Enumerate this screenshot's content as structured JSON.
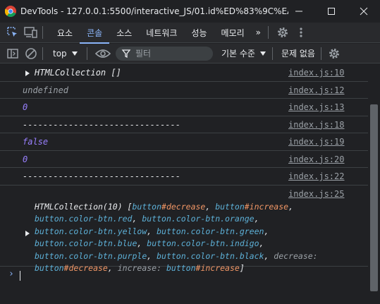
{
  "window": {
    "title": "DevTools - 127.0.0.1:5500/interactive_JS/01.id%ED%83%9C%EA%B7...",
    "minimize_icon": "minimize-icon",
    "maximize_icon": "maximize-icon",
    "close_icon": "close-icon"
  },
  "tabs": [
    {
      "label": "요소",
      "active": false
    },
    {
      "label": "콘솔",
      "active": true
    },
    {
      "label": "소스",
      "active": false
    },
    {
      "label": "네트워크",
      "active": false
    },
    {
      "label": "성능",
      "active": false
    },
    {
      "label": "메모리",
      "active": false
    }
  ],
  "more_tabs": "»",
  "toolbar": {
    "context": "top",
    "filter_placeholder": "필터",
    "levels": "기본 수준",
    "issues": "문제 없음"
  },
  "console_rows": [
    {
      "text": "HTMLCollection []",
      "type": "object",
      "source": "index.js:10"
    },
    {
      "text": "undefined",
      "type": "undefined",
      "source": "index.js:12"
    },
    {
      "text": "0",
      "type": "number",
      "source": "index.js:13"
    },
    {
      "text": "-------------------------------",
      "type": "plain",
      "source": "index.js:18"
    },
    {
      "text": "false",
      "type": "boolean",
      "source": "index.js:19"
    },
    {
      "text": "0",
      "type": "number",
      "source": "index.js:20"
    },
    {
      "text": "-------------------------------",
      "type": "plain",
      "source": "index.js:22"
    }
  ],
  "collection_row": {
    "source": "index.js:25",
    "header": "HTMLCollection(10) [",
    "items": [
      "button#decrease",
      "button#increase",
      "button.color-btn.red",
      "button.color-btn.orange",
      "button.color-btn.yellow",
      "button.color-btn.green",
      "button.color-btn.blue",
      "button.color-btn.indigo",
      "button.color-btn.purple",
      "button.color-btn.black"
    ],
    "named": [
      {
        "key": "decrease",
        "value": "button#decrease"
      },
      {
        "key": "increase",
        "value": "button#increase"
      }
    ]
  },
  "colors": {
    "accent": "#8ab4f8",
    "background": "#202124",
    "toolbar": "#292a2d",
    "number": "#9980ff",
    "element": "#5db0d7",
    "id": "#f29766"
  }
}
